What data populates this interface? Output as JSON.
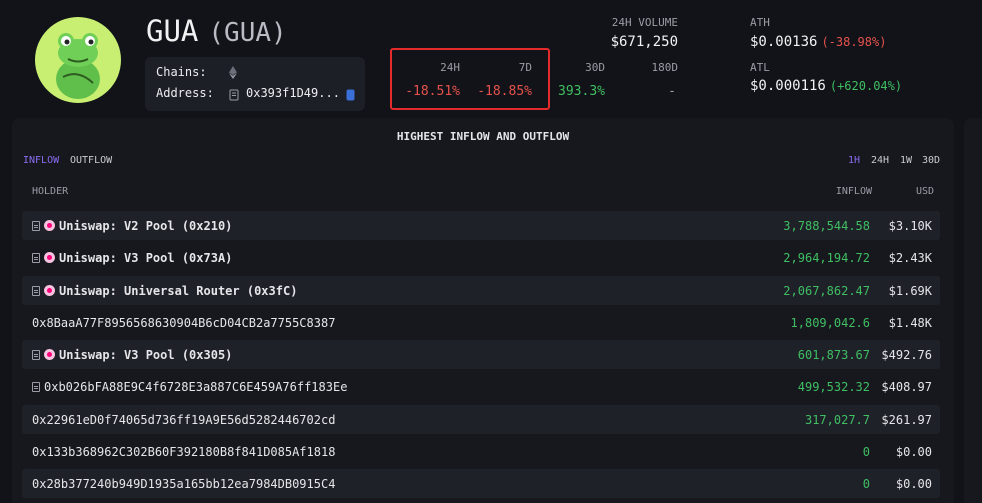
{
  "token": {
    "name": "GUA",
    "symbol": "(GUA)"
  },
  "meta": {
    "chains_label": "Chains:",
    "chain_icon": "ethereum-icon",
    "address_label": "Address:",
    "address_value": "0x393f1D49...",
    "copy_icon": "copy-icon",
    "wallet_icon": "wallet-icon"
  },
  "volume": {
    "label": "24H VOLUME",
    "value": "$671,250"
  },
  "changes": {
    "headers": [
      "24H",
      "7D",
      "30D",
      "180D"
    ],
    "values": [
      "-18.51%",
      "-18.85%",
      "393.3%",
      "-"
    ]
  },
  "ath": {
    "label": "ATH",
    "value": "$0.00136",
    "pct": "(-38.98%)"
  },
  "atl": {
    "label": "ATL",
    "value": "$0.000116",
    "pct": "(+620.04%)"
  },
  "panel": {
    "title": "HIGHEST INFLOW AND OUTFLOW",
    "flow_tabs": [
      "INFLOW",
      "OUTFLOW"
    ],
    "time_tabs": [
      "1H",
      "24H",
      "1W",
      "30D"
    ],
    "columns": {
      "holder": "HOLDER",
      "inflow": "INFLOW",
      "usd": "USD"
    },
    "rows": [
      {
        "holder": "Uniswap: V2 Pool (0x210)",
        "inflow": "3,788,544.58",
        "usd": "$3.10K"
      },
      {
        "holder": "Uniswap: V3 Pool (0x73A)",
        "inflow": "2,964,194.72",
        "usd": "$2.43K"
      },
      {
        "holder": "Uniswap: Universal Router (0x3fC)",
        "inflow": "2,067,862.47",
        "usd": "$1.69K"
      },
      {
        "holder": "0x8BaaA77F8956568630904B6cD04CB2a7755C8387",
        "inflow": "1,809,042.6",
        "usd": "$1.48K"
      },
      {
        "holder": "Uniswap: V3 Pool (0x305)",
        "inflow": "601,873.67",
        "usd": "$492.76"
      },
      {
        "holder": "0xb026bFA88E9C4f6728E3a887C6E459A76ff183Ee",
        "inflow": "499,532.32",
        "usd": "$408.97"
      },
      {
        "holder": "0x22961eD0f74065d736ff19A9E56d5282446702cd",
        "inflow": "317,027.7",
        "usd": "$261.97"
      },
      {
        "holder": "0x133b368962C302B60F392180B8f841D085Af1818",
        "inflow": "0",
        "usd": "$0.00"
      },
      {
        "holder": "0x28b377240b949D1935a165bb12ea7984DB0915C4",
        "inflow": "0",
        "usd": "$0.00"
      }
    ]
  }
}
